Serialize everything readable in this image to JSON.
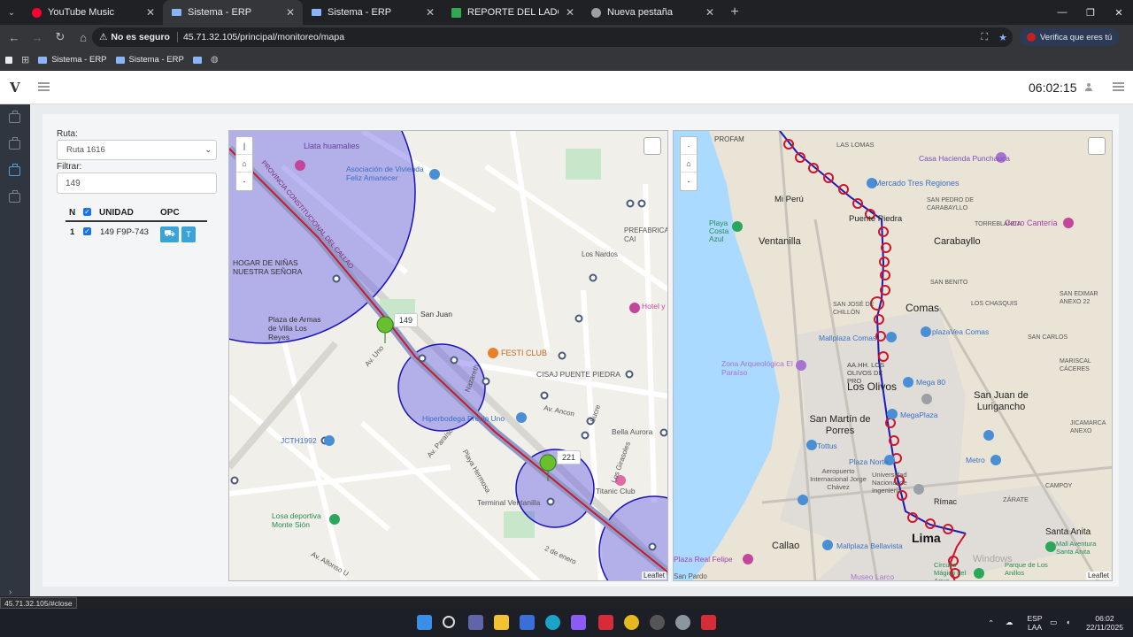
{
  "browser": {
    "tabs": [
      {
        "label": "YouTube Music",
        "favicon_color": "#ff0033",
        "active": false
      },
      {
        "label": "Sistema - ERP",
        "favicon_color": "#8ab4f8",
        "active": true
      },
      {
        "label": "Sistema - ERP",
        "favicon_color": "#8ab4f8",
        "active": false
      },
      {
        "label": "REPORTE DEL LADO A VIPUSA",
        "favicon_color": "#34a853",
        "active": false
      },
      {
        "label": "Nueva pestaña",
        "favicon_color": "#9aa0a6",
        "active": false
      }
    ],
    "security_label": "No es seguro",
    "url": "45.71.32.105/principal/monitoreo/mapa",
    "verify_label": "Verifica que eres tú",
    "bookmarks": [
      "Sistema - ERP",
      "Sistema - ERP"
    ]
  },
  "app": {
    "logo": "V",
    "clock": "06:02:15"
  },
  "filters": {
    "ruta_label": "Ruta:",
    "ruta_value": "Ruta 1616",
    "filtrar_label": "Filtrar:",
    "filtrar_value": "149"
  },
  "table": {
    "headers": {
      "n": "N",
      "unidad": "UNIDAD",
      "opc": "OPC"
    },
    "rows": [
      {
        "n": "1",
        "unidad": "149 F9P-743",
        "btn2": "T"
      }
    ]
  },
  "map_left": {
    "labels": [
      "Llata huamalies",
      "Asociación de Vivienda Feliz Amanecer",
      "PREFABRICA CAI",
      "HOGAR DE NIÑAS NUESTRA SEÑORA",
      "Plaza de Armas de Villa Los Reyes",
      "San Juan",
      "FESTI CLUB",
      "CISAJ PUENTE PIEDRA",
      "Hotel y Las Am",
      "Hiperbodega Precio Uno",
      "Av. Ancon",
      "Bella Aurora",
      "JCTH1992",
      "Titanic Club",
      "Terminal Ventanilla",
      "Losa deportiva Monte Sión",
      "Playa Hermosa",
      "Av. Paraíso",
      "PROVINCIA CONSTITUCIONAL DEL CALLAO",
      "Av. Uno",
      "Av. Alfonso U",
      "2 de enero",
      "Nazareth",
      "Sucre",
      "Los Nardos",
      "Los Girasoles"
    ],
    "markers": [
      {
        "label": "149"
      },
      {
        "label": "221"
      }
    ],
    "attribution": "Leaflet"
  },
  "map_right": {
    "labels": [
      "PROFAM",
      "LAS LOMAS",
      "Casa Hacienda Punchauca",
      "Mercado Tres Regiones",
      "Mi Perú",
      "Puente Piedra",
      "SAN PEDRO DE CARABAYLLO",
      "TORREBLANCA",
      "Playa Costa Azul",
      "Ventanilla",
      "Carabayllo",
      "Cerro Cantería",
      "Comas",
      "SAN BENITO",
      "LOS CHASQUIS",
      "Mallplaza Comas",
      "plazaVea Comas",
      "SAN JOSÉ DE CHILLÓN",
      "SAN CARLOS",
      "SAN EDIMAR ANEXO 22",
      "Zona Arqueológica El Paraíso",
      "AA.HH. LOS OLIVOS DE PRO",
      "Los Olivos",
      "Mega 80",
      "San Juan de Lurigancho",
      "MARISCAL CÁCERES",
      "San Martín de Porres",
      "Aeropuerto Internacional Jorge Chávez",
      "MegaPlaza",
      "Tottus",
      "Plaza Norte",
      "Universidad Nacional de Ingeniería",
      "Metro",
      "JICAMARCA ANEXO",
      "CAMPOY",
      "ZÁRATE",
      "Rímac",
      "Callao",
      "Lima",
      "Santa Anita",
      "Mall Aventura Santa Anita",
      "Parque de Los Anillos",
      "Mallplaza Bellavista",
      "Circuito Mágico del Agua",
      "Museo Larco",
      "Plaza Real Felipe",
      "San Pardo",
      "Windows"
    ],
    "attribution": "Leaflet"
  },
  "status_url": "45.71.32.105/#close",
  "taskbar": {
    "lang_top": "ESP",
    "lang_bottom": "LAA",
    "time": "06:02",
    "date": "22/11/2025"
  }
}
